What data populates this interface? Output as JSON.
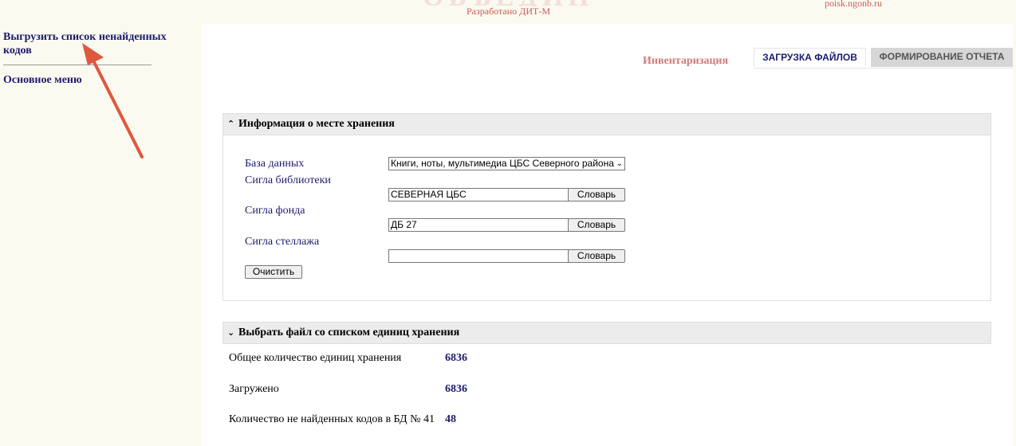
{
  "header": {
    "developed_by": "Разработано ДИТ-М",
    "site_url": "poisk.ngonb.ru"
  },
  "sidebar": {
    "items": [
      {
        "label": "Выгрузить список ненайденных кодов"
      },
      {
        "label": "Основное меню"
      }
    ]
  },
  "tabs": {
    "section_label": "Инвентаризация",
    "items": [
      {
        "label": "ЗАГРУЗКА ФАЙЛОВ",
        "active": true
      },
      {
        "label": "ФОРМИРОВАНИЕ ОТЧЕТА",
        "active": false
      }
    ]
  },
  "storage_panel": {
    "title": "Информация о месте хранения",
    "database_label": "База данных",
    "database_value": "Книги, ноты, мультимедиа ЦБС Северного района",
    "library_label": "Сигла библиотеки",
    "library_value": "СЕВЕРНАЯ ЦБС",
    "fund_label": "Сигла фонда",
    "fund_value": "ДБ 27",
    "shelf_label": "Сигла стеллажа",
    "shelf_value": "",
    "dict_button": "Словарь",
    "clear_button": "Очистить"
  },
  "file_panel": {
    "title": "Выбрать файл со списком единиц хранения"
  },
  "stats": [
    {
      "label": "Общее количество единиц хранения",
      "value": "6836"
    },
    {
      "label": "Загружено",
      "value": "6836"
    },
    {
      "label": "Количество не найденных кодов в БД № 41",
      "value": "48"
    }
  ],
  "colors": {
    "link": "#1b1b6e",
    "accent": "#d07a7a",
    "annotation_arrow": "#e0573f"
  }
}
